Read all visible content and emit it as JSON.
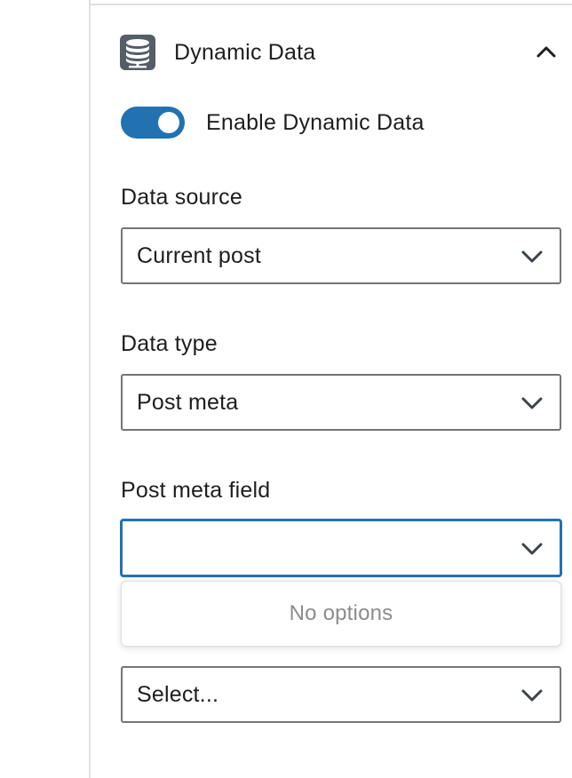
{
  "panel": {
    "title": "Dynamic Data",
    "icon": "database-icon",
    "collapse_icon": "chevron-up-icon"
  },
  "toggle": {
    "label": "Enable Dynamic Data",
    "enabled": true,
    "on_color": "#2271b1"
  },
  "fields": [
    {
      "label": "Data source",
      "value": "Current post"
    },
    {
      "label": "Data type",
      "value": "Post meta"
    },
    {
      "label": "Post meta field",
      "value": ""
    },
    {
      "label": "",
      "value": "Select..."
    }
  ],
  "dropdown": {
    "empty_text": "No options"
  },
  "colors": {
    "accent": "#2271b1",
    "border": "#757575",
    "icon_gray": "#555d66"
  }
}
